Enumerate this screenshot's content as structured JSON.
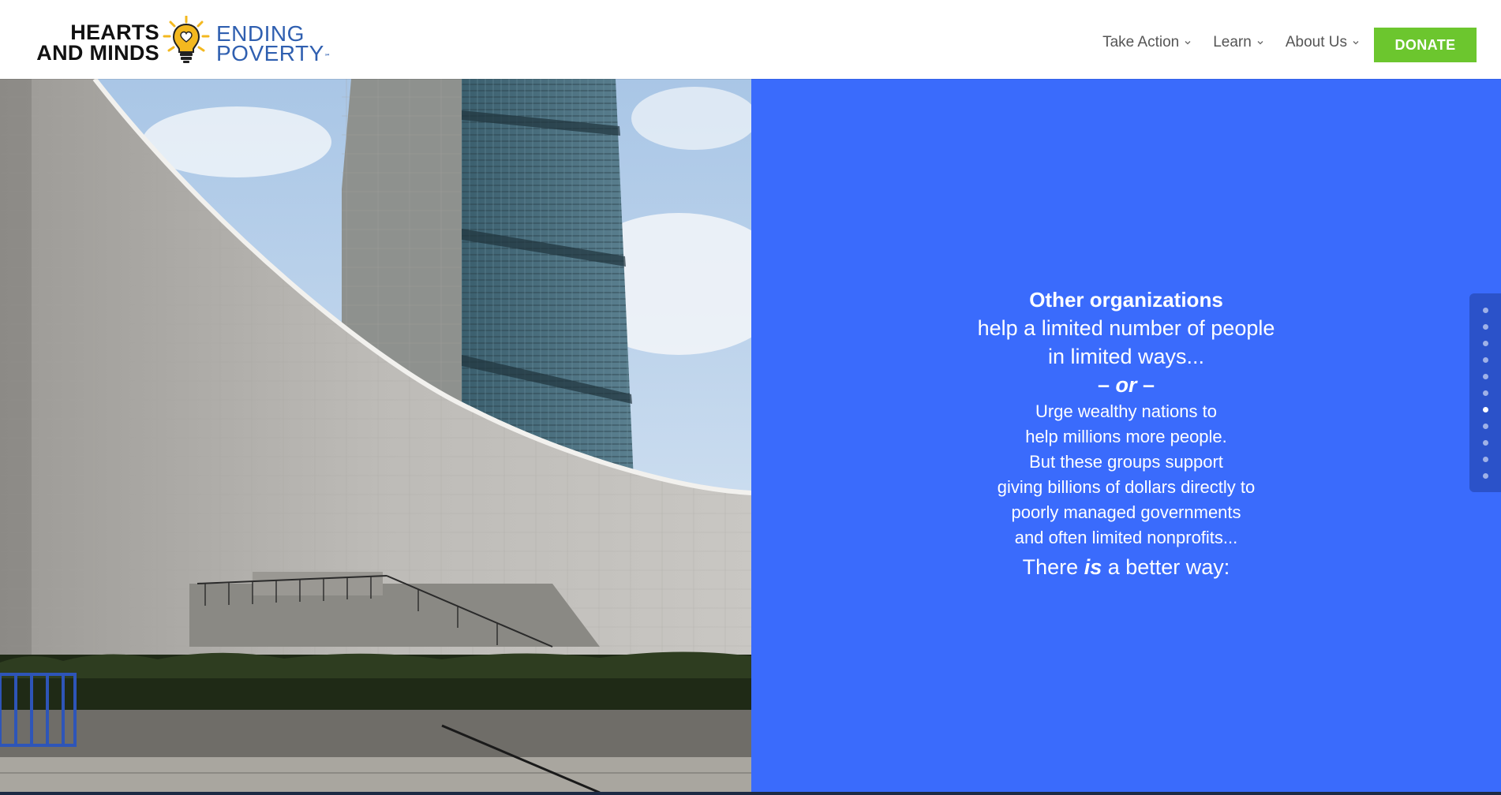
{
  "logo": {
    "left_line1": "HEARTS",
    "left_line2": "AND MINDS",
    "right_line1": "ENDING",
    "right_line2": "POVERTY",
    "mark": "℠",
    "bulb_icon": "lightbulb-heart-icon",
    "colors": {
      "dark": "#111111",
      "blue": "#2f5fb0",
      "yellow": "#f3b81f"
    }
  },
  "nav": {
    "items": [
      {
        "label": "Take Action",
        "icon": "chevron-down-icon"
      },
      {
        "label": "Learn",
        "icon": "chevron-down-icon"
      },
      {
        "label": "About Us",
        "icon": "chevron-down-icon"
      }
    ],
    "donate_label": "DONATE",
    "donate_color": "#6cc62e"
  },
  "panel": {
    "background": "#3a6bfc",
    "heading": "Other organizations",
    "line1": "help a limited number of people",
    "line2": "in limited ways...",
    "or_prefix": "– ",
    "or_word": "or",
    "or_suffix": " –",
    "small_lines": [
      "Urge wealthy nations to",
      "help millions more people.",
      "But these groups support",
      "giving billions of dollars directly to",
      "poorly managed governments",
      "and often limited nonprofits..."
    ],
    "last_prefix": "There ",
    "last_em": "is",
    "last_suffix": " a better way:"
  },
  "side_nav": {
    "dot_count": 11,
    "active_index": 6
  }
}
